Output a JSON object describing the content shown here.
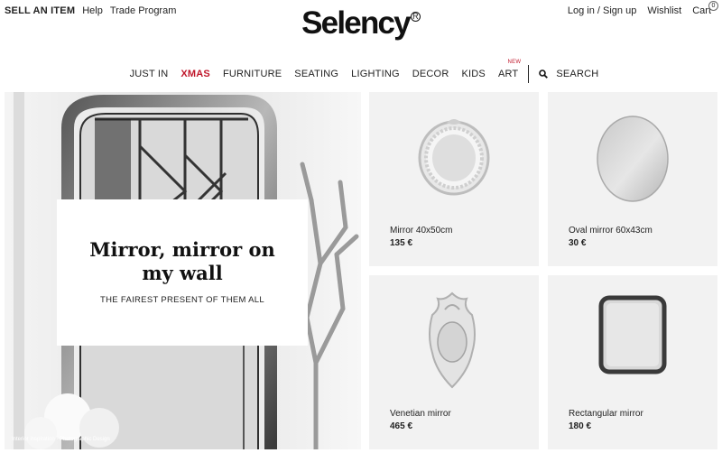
{
  "topbar": {
    "sell_label": "SELL AN ITEM",
    "help_label": "Help",
    "trade_label": "Trade Program",
    "login_label": "Log in / Sign up",
    "wishlist_label": "Wishlist",
    "cart_label": "Cart",
    "cart_count": "0"
  },
  "logo": {
    "text": "Selency",
    "reg": "R"
  },
  "nav": {
    "items": [
      "JUST IN",
      "XMAS",
      "FURNITURE",
      "SEATING",
      "LIGHTING",
      "DECOR",
      "KIDS",
      "ART"
    ],
    "new_badge": "NEW",
    "search_label": "SEARCH"
  },
  "hero": {
    "title": "Mirror, mirror on my wall",
    "subtitle": "THE FAIREST PRESENT OF THEM ALL",
    "credit": "Interior inspiration - Photographic Design"
  },
  "products": [
    {
      "name": "Mirror 40x50cm",
      "price": "135 €",
      "icon": "ornate-round-mirror"
    },
    {
      "name": "Oval mirror 60x43cm",
      "price": "30 €",
      "icon": "oval-mirror"
    },
    {
      "name": "Venetian mirror",
      "price": "465 €",
      "icon": "venetian-mirror"
    },
    {
      "name": "Rectangular mirror",
      "price": "180 €",
      "icon": "rectangular-mirror"
    }
  ],
  "colors": {
    "accent": "#c0172b",
    "card_bg": "#f2f2f2"
  }
}
